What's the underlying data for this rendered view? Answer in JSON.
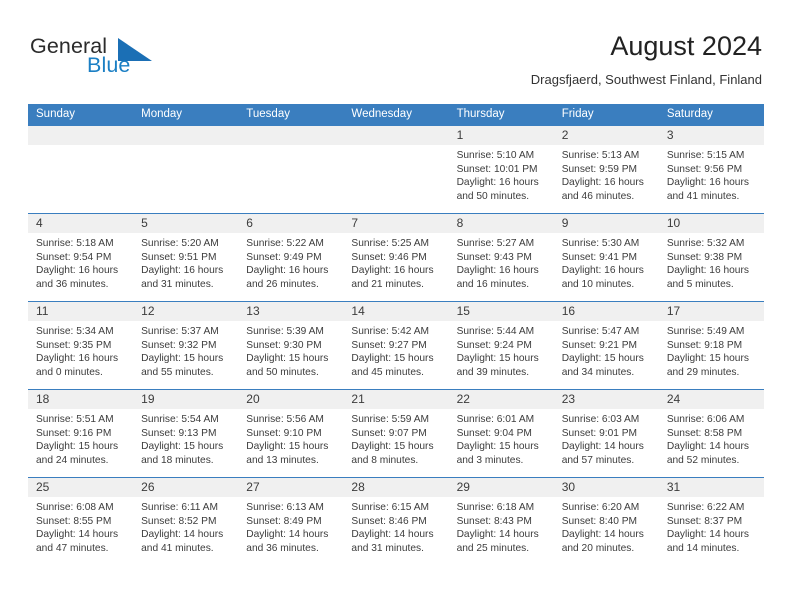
{
  "brand": {
    "name_part1": "General",
    "name_part2": "Blue",
    "logo_icon": "triangle-logo-icon",
    "color_primary": "#1b7fc4",
    "color_dark": "#2b2b2b"
  },
  "header": {
    "title": "August 2024",
    "subtitle": "Dragsfjaerd, Southwest Finland, Finland"
  },
  "theme": {
    "header_blue": "#3a7ebf",
    "date_band_gray": "#f0f0f0",
    "text_color": "#3c3c3c"
  },
  "weekdays": [
    "Sunday",
    "Monday",
    "Tuesday",
    "Wednesday",
    "Thursday",
    "Friday",
    "Saturday"
  ],
  "weeks": [
    {
      "days": [
        {
          "date": "",
          "empty": true,
          "lines": [
            "",
            "",
            "",
            ""
          ]
        },
        {
          "date": "",
          "empty": true,
          "lines": [
            "",
            "",
            "",
            ""
          ]
        },
        {
          "date": "",
          "empty": true,
          "lines": [
            "",
            "",
            "",
            ""
          ]
        },
        {
          "date": "",
          "empty": true,
          "lines": [
            "",
            "",
            "",
            ""
          ]
        },
        {
          "date": "1",
          "empty": false,
          "sunrise": "5:10 AM",
          "sunset": "10:01 PM",
          "daylight_hours": 16,
          "daylight_minutes": 50,
          "lines": [
            "Sunrise: 5:10 AM",
            "Sunset: 10:01 PM",
            "Daylight: 16 hours",
            "and 50 minutes."
          ]
        },
        {
          "date": "2",
          "empty": false,
          "sunrise": "5:13 AM",
          "sunset": "9:59 PM",
          "daylight_hours": 16,
          "daylight_minutes": 46,
          "lines": [
            "Sunrise: 5:13 AM",
            "Sunset: 9:59 PM",
            "Daylight: 16 hours",
            "and 46 minutes."
          ]
        },
        {
          "date": "3",
          "empty": false,
          "sunrise": "5:15 AM",
          "sunset": "9:56 PM",
          "daylight_hours": 16,
          "daylight_minutes": 41,
          "lines": [
            "Sunrise: 5:15 AM",
            "Sunset: 9:56 PM",
            "Daylight: 16 hours",
            "and 41 minutes."
          ]
        }
      ]
    },
    {
      "days": [
        {
          "date": "4",
          "empty": false,
          "sunrise": "5:18 AM",
          "sunset": "9:54 PM",
          "daylight_hours": 16,
          "daylight_minutes": 36,
          "lines": [
            "Sunrise: 5:18 AM",
            "Sunset: 9:54 PM",
            "Daylight: 16 hours",
            "and 36 minutes."
          ]
        },
        {
          "date": "5",
          "empty": false,
          "sunrise": "5:20 AM",
          "sunset": "9:51 PM",
          "daylight_hours": 16,
          "daylight_minutes": 31,
          "lines": [
            "Sunrise: 5:20 AM",
            "Sunset: 9:51 PM",
            "Daylight: 16 hours",
            "and 31 minutes."
          ]
        },
        {
          "date": "6",
          "empty": false,
          "sunrise": "5:22 AM",
          "sunset": "9:49 PM",
          "daylight_hours": 16,
          "daylight_minutes": 26,
          "lines": [
            "Sunrise: 5:22 AM",
            "Sunset: 9:49 PM",
            "Daylight: 16 hours",
            "and 26 minutes."
          ]
        },
        {
          "date": "7",
          "empty": false,
          "sunrise": "5:25 AM",
          "sunset": "9:46 PM",
          "daylight_hours": 16,
          "daylight_minutes": 21,
          "lines": [
            "Sunrise: 5:25 AM",
            "Sunset: 9:46 PM",
            "Daylight: 16 hours",
            "and 21 minutes."
          ]
        },
        {
          "date": "8",
          "empty": false,
          "sunrise": "5:27 AM",
          "sunset": "9:43 PM",
          "daylight_hours": 16,
          "daylight_minutes": 16,
          "lines": [
            "Sunrise: 5:27 AM",
            "Sunset: 9:43 PM",
            "Daylight: 16 hours",
            "and 16 minutes."
          ]
        },
        {
          "date": "9",
          "empty": false,
          "sunrise": "5:30 AM",
          "sunset": "9:41 PM",
          "daylight_hours": 16,
          "daylight_minutes": 10,
          "lines": [
            "Sunrise: 5:30 AM",
            "Sunset: 9:41 PM",
            "Daylight: 16 hours",
            "and 10 minutes."
          ]
        },
        {
          "date": "10",
          "empty": false,
          "sunrise": "5:32 AM",
          "sunset": "9:38 PM",
          "daylight_hours": 16,
          "daylight_minutes": 5,
          "lines": [
            "Sunrise: 5:32 AM",
            "Sunset: 9:38 PM",
            "Daylight: 16 hours",
            "and 5 minutes."
          ]
        }
      ]
    },
    {
      "days": [
        {
          "date": "11",
          "empty": false,
          "sunrise": "5:34 AM",
          "sunset": "9:35 PM",
          "daylight_hours": 16,
          "daylight_minutes": 0,
          "lines": [
            "Sunrise: 5:34 AM",
            "Sunset: 9:35 PM",
            "Daylight: 16 hours",
            "and 0 minutes."
          ]
        },
        {
          "date": "12",
          "empty": false,
          "sunrise": "5:37 AM",
          "sunset": "9:32 PM",
          "daylight_hours": 15,
          "daylight_minutes": 55,
          "lines": [
            "Sunrise: 5:37 AM",
            "Sunset: 9:32 PM",
            "Daylight: 15 hours",
            "and 55 minutes."
          ]
        },
        {
          "date": "13",
          "empty": false,
          "sunrise": "5:39 AM",
          "sunset": "9:30 PM",
          "daylight_hours": 15,
          "daylight_minutes": 50,
          "lines": [
            "Sunrise: 5:39 AM",
            "Sunset: 9:30 PM",
            "Daylight: 15 hours",
            "and 50 minutes."
          ]
        },
        {
          "date": "14",
          "empty": false,
          "sunrise": "5:42 AM",
          "sunset": "9:27 PM",
          "daylight_hours": 15,
          "daylight_minutes": 45,
          "lines": [
            "Sunrise: 5:42 AM",
            "Sunset: 9:27 PM",
            "Daylight: 15 hours",
            "and 45 minutes."
          ]
        },
        {
          "date": "15",
          "empty": false,
          "sunrise": "5:44 AM",
          "sunset": "9:24 PM",
          "daylight_hours": 15,
          "daylight_minutes": 39,
          "lines": [
            "Sunrise: 5:44 AM",
            "Sunset: 9:24 PM",
            "Daylight: 15 hours",
            "and 39 minutes."
          ]
        },
        {
          "date": "16",
          "empty": false,
          "sunrise": "5:47 AM",
          "sunset": "9:21 PM",
          "daylight_hours": 15,
          "daylight_minutes": 34,
          "lines": [
            "Sunrise: 5:47 AM",
            "Sunset: 9:21 PM",
            "Daylight: 15 hours",
            "and 34 minutes."
          ]
        },
        {
          "date": "17",
          "empty": false,
          "sunrise": "5:49 AM",
          "sunset": "9:18 PM",
          "daylight_hours": 15,
          "daylight_minutes": 29,
          "lines": [
            "Sunrise: 5:49 AM",
            "Sunset: 9:18 PM",
            "Daylight: 15 hours",
            "and 29 minutes."
          ]
        }
      ]
    },
    {
      "days": [
        {
          "date": "18",
          "empty": false,
          "sunrise": "5:51 AM",
          "sunset": "9:16 PM",
          "daylight_hours": 15,
          "daylight_minutes": 24,
          "lines": [
            "Sunrise: 5:51 AM",
            "Sunset: 9:16 PM",
            "Daylight: 15 hours",
            "and 24 minutes."
          ]
        },
        {
          "date": "19",
          "empty": false,
          "sunrise": "5:54 AM",
          "sunset": "9:13 PM",
          "daylight_hours": 15,
          "daylight_minutes": 18,
          "lines": [
            "Sunrise: 5:54 AM",
            "Sunset: 9:13 PM",
            "Daylight: 15 hours",
            "and 18 minutes."
          ]
        },
        {
          "date": "20",
          "empty": false,
          "sunrise": "5:56 AM",
          "sunset": "9:10 PM",
          "daylight_hours": 15,
          "daylight_minutes": 13,
          "lines": [
            "Sunrise: 5:56 AM",
            "Sunset: 9:10 PM",
            "Daylight: 15 hours",
            "and 13 minutes."
          ]
        },
        {
          "date": "21",
          "empty": false,
          "sunrise": "5:59 AM",
          "sunset": "9:07 PM",
          "daylight_hours": 15,
          "daylight_minutes": 8,
          "lines": [
            "Sunrise: 5:59 AM",
            "Sunset: 9:07 PM",
            "Daylight: 15 hours",
            "and 8 minutes."
          ]
        },
        {
          "date": "22",
          "empty": false,
          "sunrise": "6:01 AM",
          "sunset": "9:04 PM",
          "daylight_hours": 15,
          "daylight_minutes": 3,
          "lines": [
            "Sunrise: 6:01 AM",
            "Sunset: 9:04 PM",
            "Daylight: 15 hours",
            "and 3 minutes."
          ]
        },
        {
          "date": "23",
          "empty": false,
          "sunrise": "6:03 AM",
          "sunset": "9:01 PM",
          "daylight_hours": 14,
          "daylight_minutes": 57,
          "lines": [
            "Sunrise: 6:03 AM",
            "Sunset: 9:01 PM",
            "Daylight: 14 hours",
            "and 57 minutes."
          ]
        },
        {
          "date": "24",
          "empty": false,
          "sunrise": "6:06 AM",
          "sunset": "8:58 PM",
          "daylight_hours": 14,
          "daylight_minutes": 52,
          "lines": [
            "Sunrise: 6:06 AM",
            "Sunset: 8:58 PM",
            "Daylight: 14 hours",
            "and 52 minutes."
          ]
        }
      ]
    },
    {
      "days": [
        {
          "date": "25",
          "empty": false,
          "sunrise": "6:08 AM",
          "sunset": "8:55 PM",
          "daylight_hours": 14,
          "daylight_minutes": 47,
          "lines": [
            "Sunrise: 6:08 AM",
            "Sunset: 8:55 PM",
            "Daylight: 14 hours",
            "and 47 minutes."
          ]
        },
        {
          "date": "26",
          "empty": false,
          "sunrise": "6:11 AM",
          "sunset": "8:52 PM",
          "daylight_hours": 14,
          "daylight_minutes": 41,
          "lines": [
            "Sunrise: 6:11 AM",
            "Sunset: 8:52 PM",
            "Daylight: 14 hours",
            "and 41 minutes."
          ]
        },
        {
          "date": "27",
          "empty": false,
          "sunrise": "6:13 AM",
          "sunset": "8:49 PM",
          "daylight_hours": 14,
          "daylight_minutes": 36,
          "lines": [
            "Sunrise: 6:13 AM",
            "Sunset: 8:49 PM",
            "Daylight: 14 hours",
            "and 36 minutes."
          ]
        },
        {
          "date": "28",
          "empty": false,
          "sunrise": "6:15 AM",
          "sunset": "8:46 PM",
          "daylight_hours": 14,
          "daylight_minutes": 31,
          "lines": [
            "Sunrise: 6:15 AM",
            "Sunset: 8:46 PM",
            "Daylight: 14 hours",
            "and 31 minutes."
          ]
        },
        {
          "date": "29",
          "empty": false,
          "sunrise": "6:18 AM",
          "sunset": "8:43 PM",
          "daylight_hours": 14,
          "daylight_minutes": 25,
          "lines": [
            "Sunrise: 6:18 AM",
            "Sunset: 8:43 PM",
            "Daylight: 14 hours",
            "and 25 minutes."
          ]
        },
        {
          "date": "30",
          "empty": false,
          "sunrise": "6:20 AM",
          "sunset": "8:40 PM",
          "daylight_hours": 14,
          "daylight_minutes": 20,
          "lines": [
            "Sunrise: 6:20 AM",
            "Sunset: 8:40 PM",
            "Daylight: 14 hours",
            "and 20 minutes."
          ]
        },
        {
          "date": "31",
          "empty": false,
          "sunrise": "6:22 AM",
          "sunset": "8:37 PM",
          "daylight_hours": 14,
          "daylight_minutes": 14,
          "lines": [
            "Sunrise: 6:22 AM",
            "Sunset: 8:37 PM",
            "Daylight: 14 hours",
            "and 14 minutes."
          ]
        }
      ]
    }
  ]
}
